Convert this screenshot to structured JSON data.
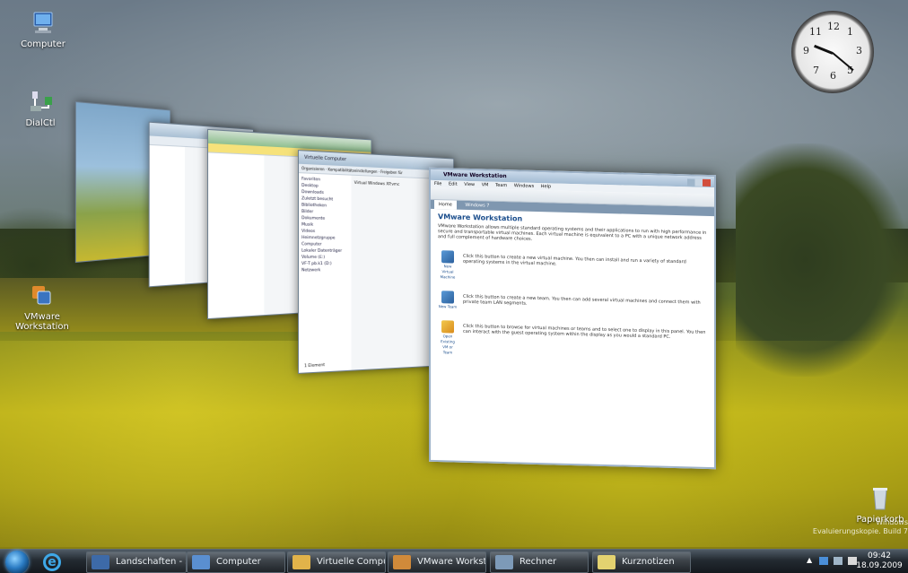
{
  "desktop": {
    "icons": [
      {
        "label": "Computer",
        "icon": "computer-icon"
      },
      {
        "label": "DialCtl",
        "icon": "network-icon"
      },
      {
        "label": "VMware Workstation",
        "icon": "vmware-icon"
      },
      {
        "label": "Papierkorb",
        "icon": "recycle-bin-icon"
      }
    ]
  },
  "clock_gadget": {
    "hours": [
      12,
      1,
      3,
      5,
      6,
      7,
      9,
      11
    ]
  },
  "flip3d": {
    "front_window": {
      "title": "VMware Workstation",
      "menu": [
        "File",
        "Edit",
        "View",
        "VM",
        "Team",
        "Windows",
        "Help"
      ],
      "tabs": [
        "Home",
        "Windows 7"
      ],
      "heading": "VMware Workstation",
      "intro": "VMware Workstation allows multiple standard operating systems and their applications to run with high performance in secure and transportable virtual machines. Each virtual machine is equivalent to a PC with a unique network address and full complement of hardware choices.",
      "actions": [
        {
          "label": "New Virtual Machine",
          "text": "Click this button to create a new virtual machine. You then can install and run a variety of standard operating systems in the virtual machine."
        },
        {
          "label": "New Team",
          "text": "Click this button to create a new team. You then can add several virtual machines and connect them with private team LAN segments."
        },
        {
          "label": "Open Existing VM or Team",
          "text": "Click this button to browse for virtual machines or teams and to select one to display in this panel. You then can interact with the guest operating system within the display as you would a standard PC."
        }
      ]
    },
    "explorer_window": {
      "address": "Virtuelle Computer",
      "toolbar": [
        "Organisieren",
        "Kompatibilitätseinstellungen",
        "Freigeben für"
      ],
      "nav": [
        "Favoriten",
        "Desktop",
        "Downloads",
        "Zuletzt besucht",
        "Bibliotheken",
        "Bilder",
        "Dokumente",
        "Musik",
        "Videos",
        "Heimnetzgruppe",
        "Computer",
        "Lokaler Datenträger",
        "Volume (E:)",
        "VF-T pb.k1 (D:)",
        "Netzwerk"
      ],
      "item": "Virtual Windows XP.vmc",
      "status": "1 Element"
    }
  },
  "taskbar": {
    "tasks": [
      {
        "label": "Landschaften - Su...",
        "color": "#3d6aa8"
      },
      {
        "label": "Computer",
        "color": "#5a8fd0"
      },
      {
        "label": "Virtuelle Computer",
        "color": "#e2b34a"
      },
      {
        "label": "VMware Workstat...",
        "color": "#d08a3a"
      },
      {
        "label": "Rechner",
        "color": "#7d9ab8"
      },
      {
        "label": "Kurznotizen",
        "color": "#e3d270"
      }
    ],
    "time": "09:42",
    "date": "18.09.2009"
  },
  "watermark": {
    "line1": "Windows",
    "line2": "Evaluierungskopie. Build 7"
  }
}
